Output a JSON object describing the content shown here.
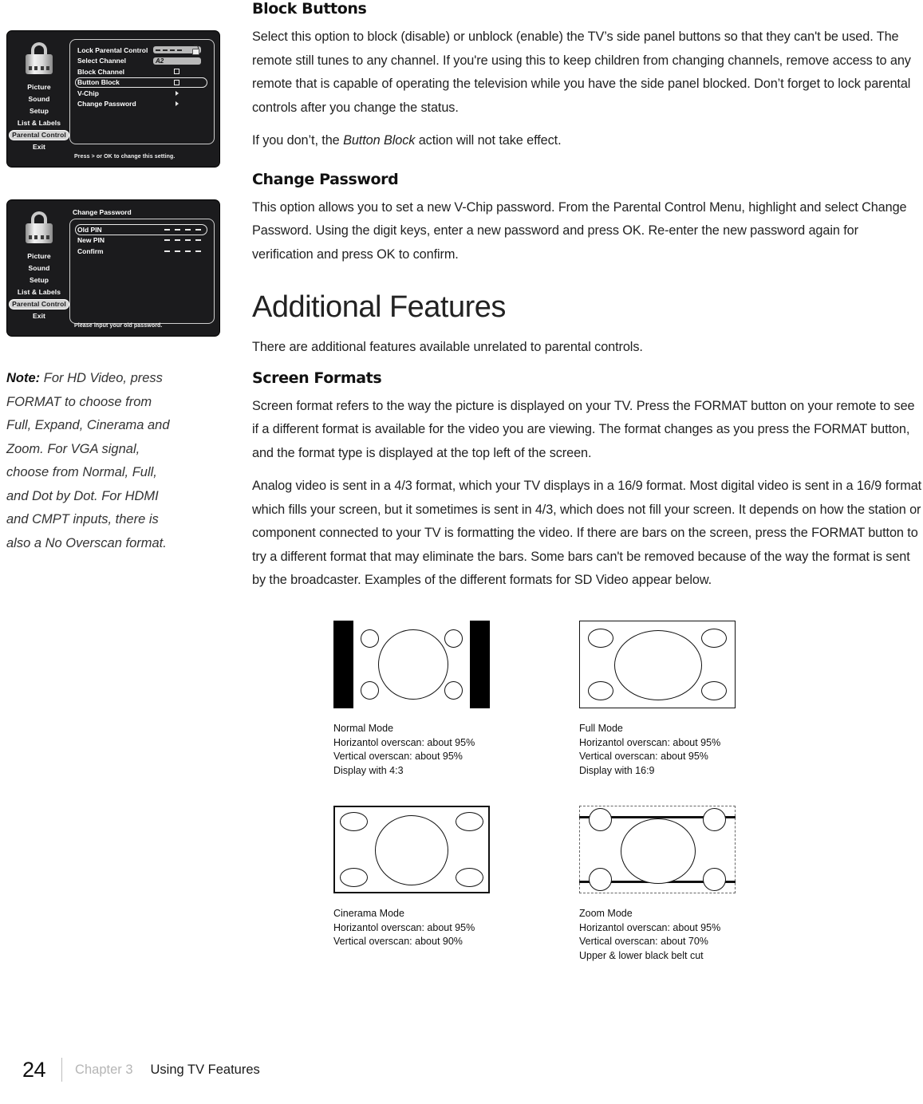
{
  "osd_menus": [
    {
      "title": "",
      "sidebar": [
        "Picture",
        "Sound",
        "Setup",
        "List & Labels",
        "Parental Control",
        "Exit"
      ],
      "selected_sidebar": "Parental Control",
      "rows": [
        {
          "label": "Lock Parental Control",
          "control": "lock-field",
          "value": "— — — —"
        },
        {
          "label": "Select Channel",
          "control": "text-field",
          "value": "A2"
        },
        {
          "label": "Block Channel",
          "control": "checkbox",
          "value": ""
        },
        {
          "label": "Button Block",
          "control": "checkbox",
          "value": "",
          "highlighted": true
        },
        {
          "label": "V-Chip",
          "control": "arrow",
          "value": ""
        },
        {
          "label": "Change Password",
          "control": "arrow",
          "value": ""
        }
      ],
      "hint": "Press > or OK to change this setting."
    },
    {
      "title": "Change Password",
      "sidebar": [
        "Picture",
        "Sound",
        "Setup",
        "List & Labels",
        "Parental Control",
        "Exit"
      ],
      "selected_sidebar": "Parental Control",
      "rows": [
        {
          "label": "Old PIN",
          "control": "pin",
          "value": "— — — —",
          "highlighted": true
        },
        {
          "label": "New PIN",
          "control": "pin",
          "value": "— — — —"
        },
        {
          "label": "Confirm",
          "control": "pin",
          "value": "— — — —"
        }
      ],
      "hint": "Please input your old password."
    }
  ],
  "note": {
    "label": "Note:",
    "text": " For HD Video, press FORMAT to choose from Full, Expand, Cinerama and Zoom. For VGA signal, choose from Normal, Full, and Dot by Dot. For HDMI and CMPT inputs, there is also a No Overscan format."
  },
  "main": {
    "block_buttons": {
      "heading": "Block Buttons",
      "para1": "Select this option to block (disable) or unblock (enable) the TV’s side panel buttons so that they can't be used. The remote still tunes to any channel. If you're using this to keep children from changing channels, remove access to any remote that is capable of operating the television while you have the side panel blocked. Don’t forget to lock parental controls after you change the status.",
      "para2_pre": "If you don’t, the ",
      "para2_em": "Button Block",
      "para2_post": " action will not take effect."
    },
    "change_password": {
      "heading": "Change Password",
      "para1": "This option allows you to set a new V-Chip password. From the Parental Control Menu, highlight and select Change Password. Using the digit keys, enter a new password and press OK. Re-enter the new password again for verification and press OK to confirm."
    },
    "additional_features": {
      "heading": "Additional Features",
      "para1": "There are additional features available unrelated to parental controls."
    },
    "screen_formats": {
      "heading": "Screen Formats",
      "para1": "Screen format refers to the way the picture is displayed on your TV. Press the FORMAT button on your remote to see if a different format is available for the video you are viewing. The format changes as you press the FORMAT button, and the format type is displayed at the top left of the screen.",
      "para2": "Analog video is sent in a 4/3 format, which your TV displays in a 16/9 format. Most digital video is sent in a 16/9 format which fills your screen, but it sometimes is sent in 4/3, which does not fill your screen. It depends on how the station or component connected to your TV is formatting the video. If there are bars on the screen, press the FORMAT button to try a different format that may eliminate the bars. Some bars can't be removed because of the way the format is sent by the broadcaster. Examples of the different formats for SD Video appear below."
    }
  },
  "diagrams": [
    {
      "id": "normal",
      "title": "Normal Mode",
      "lines": [
        "Horizantol overscan: about 95%",
        "Vertical overscan: about 95%",
        "Display with 4:3"
      ]
    },
    {
      "id": "full",
      "title": "Full Mode",
      "lines": [
        "Horizantol overscan: about 95%",
        "Vertical overscan: about 95%",
        "Display with 16:9"
      ]
    },
    {
      "id": "cinerama",
      "title": "Cinerama Mode",
      "lines": [
        "Horizantol overscan: about 95%",
        "Vertical overscan: about 90%"
      ]
    },
    {
      "id": "zoom",
      "title": "Zoom Mode",
      "lines": [
        "Horizantol overscan: about 95%",
        "Vertical overscan: about 70%",
        "Upper & lower black belt cut"
      ]
    }
  ],
  "footer": {
    "page": "24",
    "chapter": "Chapter 3",
    "section": "Using TV Features"
  }
}
